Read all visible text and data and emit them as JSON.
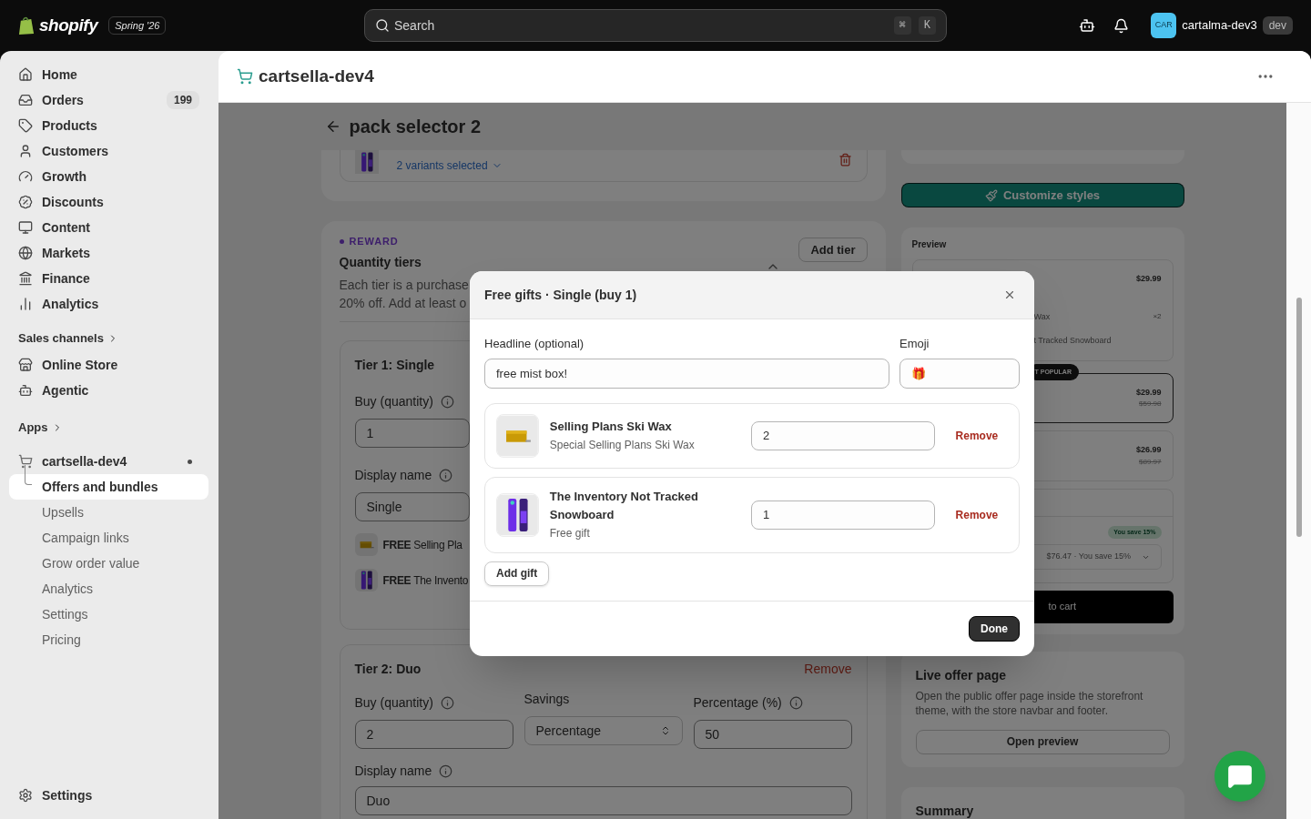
{
  "topbar": {
    "brand": "shopify",
    "edition": "Spring '26",
    "search": {
      "placeholder": "Search",
      "shortcut": [
        "⌘",
        "K"
      ]
    },
    "account": {
      "initials": "CAR",
      "name": "cartalma-dev3",
      "badge": "dev"
    }
  },
  "sidebar": {
    "items": [
      {
        "label": "Home"
      },
      {
        "label": "Orders",
        "badge": "199"
      },
      {
        "label": "Products"
      },
      {
        "label": "Customers"
      },
      {
        "label": "Growth"
      },
      {
        "label": "Discounts"
      },
      {
        "label": "Content"
      },
      {
        "label": "Markets"
      },
      {
        "label": "Finance"
      },
      {
        "label": "Analytics"
      }
    ],
    "sales_channels": {
      "title": "Sales channels",
      "items": [
        {
          "label": "Online Store"
        },
        {
          "label": "Agentic"
        }
      ]
    },
    "apps": {
      "title": "Apps"
    },
    "app": {
      "name": "cartsella-dev4",
      "items": [
        {
          "label": "Offers and bundles",
          "selected": true
        },
        {
          "label": "Upsells",
          "selected": false
        },
        {
          "label": "Campaign links",
          "selected": false
        },
        {
          "label": "Grow order value",
          "selected": false
        },
        {
          "label": "Analytics",
          "selected": false
        },
        {
          "label": "Settings",
          "selected": false
        },
        {
          "label": "Pricing",
          "selected": false
        }
      ]
    },
    "footer": {
      "label": "Settings"
    }
  },
  "app_header": {
    "title": "cartsella-dev4"
  },
  "page": {
    "title": "pack selector 2",
    "product_card": {
      "variants": "2 variants selected"
    },
    "reward": {
      "eyebrow": "REWARD",
      "title": "Quantity tiers",
      "description_lines": [
        "Each tier is a purchase",
        "20% off. Add at least o"
      ],
      "add_button": "Add tier",
      "tier_1": {
        "title": "Tier 1: Single",
        "buy_label": "Buy (quantity)",
        "buy_value": "1",
        "display_label": "Display name",
        "display_value": "Single",
        "gifts": [
          "**FREE** Selling Pla",
          "**FREE** The Invento"
        ]
      },
      "tier_2": {
        "title": "Tier 2: Duo",
        "remove": "Remove",
        "fields": [
          {
            "kind": "input",
            "label": "Buy (quantity)",
            "value": "2"
          },
          {
            "kind": "select",
            "label": "Savings",
            "value": "Percentage"
          },
          {
            "kind": "input",
            "label": "Percentage (%)",
            "value": "50"
          }
        ],
        "display_label": "Display name",
        "display_value": "Duo"
      }
    }
  },
  "sidebar_right": {
    "customize_button": "Customize styles",
    "preview": {
      "title": "Preview",
      "options": [
        {
          "price": "$29.99",
          "lines": [
            {
              "name": "Wax",
              "qty": "×2"
            },
            {
              "name": "t Tracked Snowboard"
            }
          ],
          "selected": false
        },
        {
          "badge": "T POPULAR",
          "price": "$29.99",
          "compare": "$59.98",
          "selected": true
        },
        {
          "price": "$26.99",
          "compare": "$89.97",
          "selected": false
        }
      ],
      "custom": {
        "savings_badge": "You save 15%",
        "select_value": "$76.47 · You save 15%"
      },
      "cart_button": "to cart"
    },
    "live_offer": {
      "title": "Live offer page",
      "description": "Open the public offer page inside the storefront theme, with the store navbar and footer.",
      "button": "Open preview"
    },
    "summary": {
      "title": "Summary"
    }
  },
  "modal": {
    "title": "Free gifts · Single (buy 1)",
    "headline": {
      "label": "Headline (optional)",
      "value": "free mist box!"
    },
    "emoji": {
      "label": "Emoji",
      "value": "🎁"
    },
    "gifts": [
      {
        "title": "Selling Plans Ski Wax",
        "subtitle": "Special Selling Plans Ski Wax",
        "quantity": "2",
        "remove": "Remove"
      },
      {
        "title": "The Inventory Not Tracked Snowboard",
        "subtitle": "Free gift",
        "quantity": "1",
        "remove": "Remove"
      }
    ],
    "add_button": "Add gift",
    "done_button": "Done"
  }
}
